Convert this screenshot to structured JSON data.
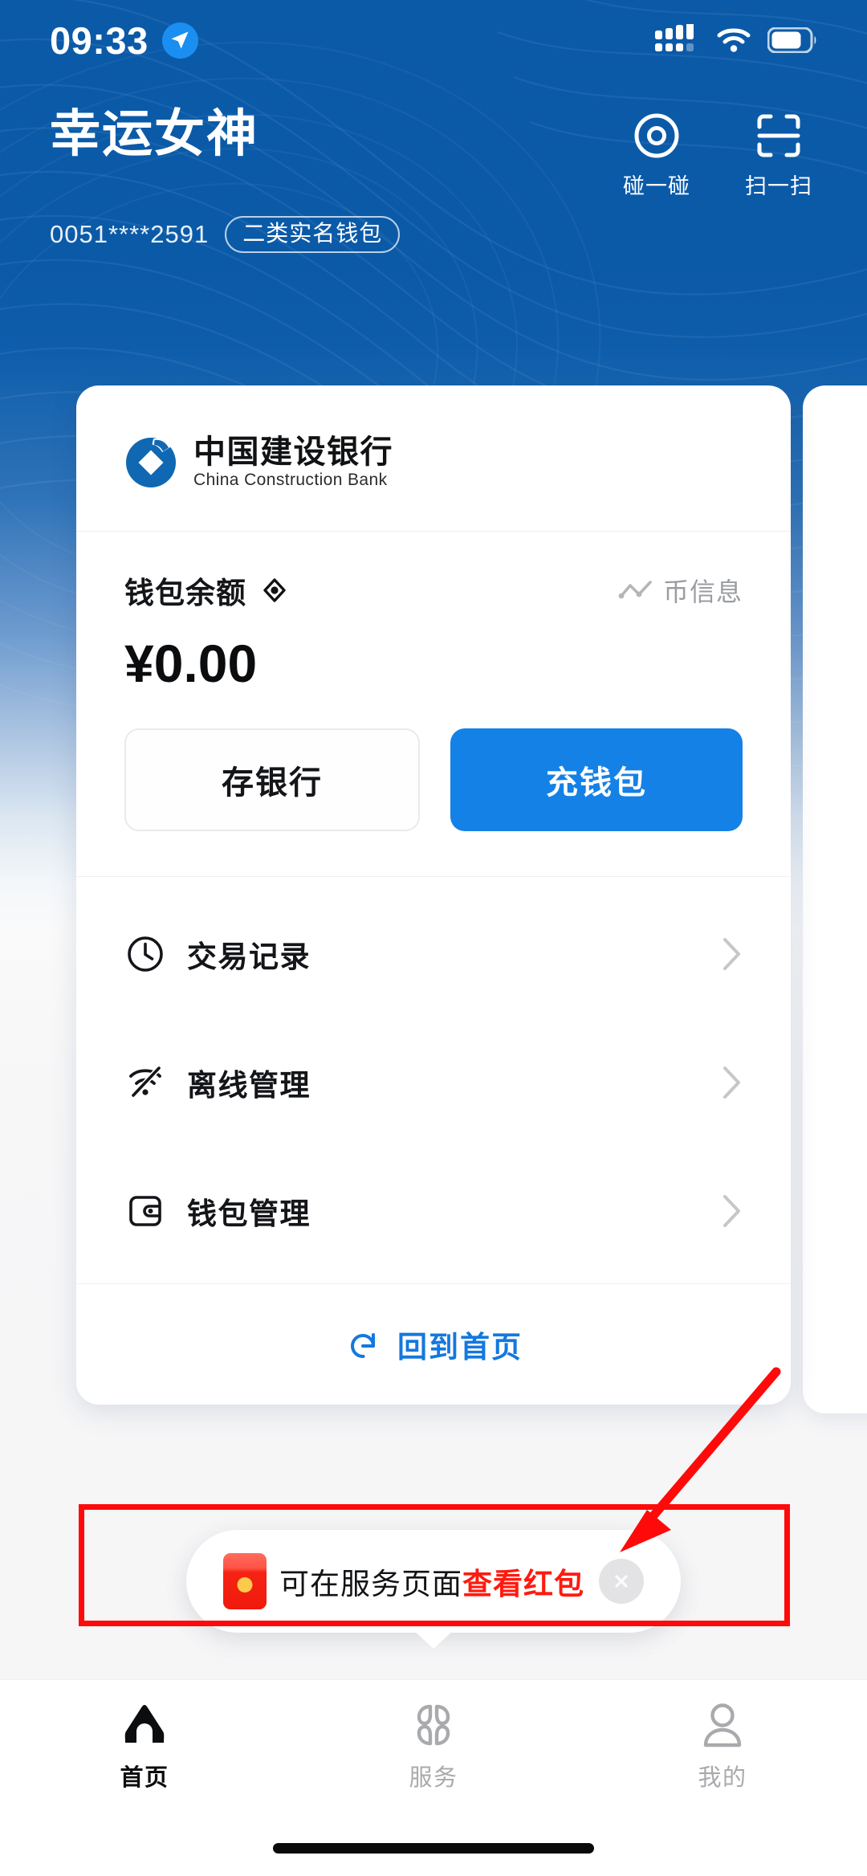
{
  "status_bar": {
    "time": "09:33",
    "location_icon": "location-arrow-icon",
    "signal_icon": "cellular-signal-icon",
    "wifi_icon": "wifi-icon",
    "battery_icon": "battery-icon"
  },
  "header": {
    "user_name": "幸运女神",
    "account_masked": "0051****2591",
    "account_tag": "二类实名钱包",
    "actions": [
      {
        "label": "碰一碰",
        "icon": "nfc-tap-icon"
      },
      {
        "label": "扫一扫",
        "icon": "scan-qr-icon"
      }
    ]
  },
  "wallet_card": {
    "bank_name_cn": "中国建设银行",
    "bank_name_en": "China Construction Bank",
    "bank_logo_icon": "ccb-logo-icon",
    "balance_label": "钱包余额",
    "balance_eye_icon": "eye-toggle-icon",
    "balance_amount": "¥0.00",
    "coin_info_label": "币信息",
    "coin_info_icon": "trend-chart-icon",
    "buttons": {
      "deposit_label": "存银行",
      "recharge_label": "充钱包"
    },
    "menu_items": [
      {
        "label": "交易记录",
        "icon": "clock-history-icon"
      },
      {
        "label": "离线管理",
        "icon": "wifi-off-icon"
      },
      {
        "label": "钱包管理",
        "icon": "wallet-icon"
      }
    ],
    "home_link_label": "回到首页",
    "home_link_icon": "refresh-return-icon"
  },
  "toast": {
    "icon": "red-envelope-icon",
    "text_normal": "可在服务页面",
    "text_highlight": "查看红包",
    "close_icon": "close-x-icon"
  },
  "bottom_nav": [
    {
      "label": "首页",
      "icon": "home-icon",
      "active": true
    },
    {
      "label": "服务",
      "icon": "grid-services-icon",
      "active": false
    },
    {
      "label": "我的",
      "icon": "person-profile-icon",
      "active": false
    }
  ],
  "annotation": {
    "highlight_box_color": "#FF0A0A",
    "arrow_color": "#FF0A0A"
  },
  "colors": {
    "header_blue": "#0B5AA8",
    "primary_blue": "#1481E6",
    "link_blue": "#1478DE",
    "highlight_red": "#FF1A0F",
    "muted_gray": "#9A9CA1"
  }
}
